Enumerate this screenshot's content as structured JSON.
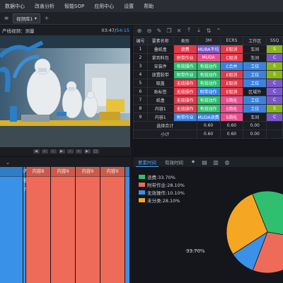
{
  "menu": [
    "数据中心",
    "改善分析",
    "智能SOP",
    "应用中心",
    "设置",
    "帮助"
  ],
  "toolbar": {
    "dropdown": "视频库1",
    "add_label": "+"
  },
  "video": {
    "title": "产线视频：测量",
    "time_current": "03:47",
    "time_total": "54:15",
    "separator": "/"
  },
  "table": {
    "columns": [
      "编号",
      "要素名称",
      "类别",
      "3M",
      "ECRS",
      "工作区",
      "SSQ"
    ],
    "rows": [
      {
        "id": "1",
        "name": "叠纸盒",
        "cat": "浪费",
        "m3": "MURA不均",
        "ecrs": "E取消",
        "area": "车间",
        "ssq": "S",
        "c_cat": "c-red",
        "c_m3": "c-purple",
        "c_ecrs": "c-red",
        "c_area": "c-dark",
        "c_ssq": "c-lime"
      },
      {
        "id": "2",
        "name": "拿到料包",
        "cat": "附带作业",
        "m3": "MUDA",
        "ecrs": "C取消",
        "area": "车间",
        "ssq": "C",
        "c_cat": "c-red",
        "c_m3": "c-pink",
        "c_ecrs": "c-red",
        "c_area": "c-dark",
        "c_ssq": "c-purple"
      },
      {
        "id": "3",
        "name": "安装件",
        "cat": "有效操作",
        "m3": "有效动作",
        "ecrs": "C合并",
        "area": "工位",
        "ssq": "S",
        "c_cat": "c-green",
        "c_m3": "c-green",
        "c_ecrs": "c-blue",
        "c_area": "c-blue",
        "c_ssq": "c-lime"
      },
      {
        "id": "4",
        "name": "放置胶带",
        "cat": "附带作业",
        "m3": "有效动作",
        "ecrs": "E取消",
        "area": "工位",
        "ssq": "S",
        "c_cat": "c-green",
        "c_m3": "c-green",
        "c_ecrs": "c-red",
        "c_area": "c-blue",
        "c_ssq": "c-lime"
      },
      {
        "id": "5",
        "name": "取盖",
        "cat": "无效操作",
        "m3": "有效动作",
        "ecrs": "E取消",
        "area": "工位",
        "ssq": "C",
        "c_cat": "c-red",
        "c_m3": "c-green",
        "c_ecrs": "c-red",
        "c_area": "c-blue",
        "c_ssq": "c-purple"
      },
      {
        "id": "6",
        "name": "贴标签",
        "cat": "无效操作",
        "m3": "附带动作",
        "ecrs": "E取消",
        "area": "区域外",
        "ssq": "C",
        "c_cat": "c-red",
        "c_m3": "c-blue",
        "c_ecrs": "c-red",
        "c_area": "c-dark",
        "c_ssq": "c-purple"
      },
      {
        "id": "7",
        "name": "纸盒",
        "cat": "无效操作",
        "m3": "有效动作",
        "ecrs": "S简化",
        "area": "工位",
        "ssq": "C",
        "c_cat": "c-red",
        "c_m3": "c-green",
        "c_ecrs": "c-pink",
        "c_area": "c-blue",
        "c_ssq": "c-purple"
      },
      {
        "id": "8",
        "name": "内容1",
        "cat": "无效操作",
        "m3": "有效动作",
        "ecrs": "S简化",
        "area": "工位",
        "ssq": "S",
        "c_cat": "c-red",
        "c_m3": "c-green",
        "c_ecrs": "c-pink",
        "c_area": "c-blue",
        "c_ssq": "c-lime"
      },
      {
        "id": "9",
        "name": "内容1",
        "cat": "附带作业",
        "m3": "MUDA浪费",
        "ecrs": "S简化",
        "area": "车间",
        "ssq": "C",
        "c_cat": "c-blue",
        "c_m3": "c-blue",
        "c_ecrs": "c-pink",
        "c_area": "c-dark",
        "c_ssq": "c-purple"
      }
    ],
    "summary": [
      {
        "label": "选择合计",
        "m3": "0.60",
        "ecrs": "0.60",
        "area": "0.00"
      },
      {
        "label": "小计",
        "m3": "0.60",
        "ecrs": "0.60",
        "area": "0.00"
      }
    ]
  },
  "timeline": {
    "segments": [
      {
        "label": "",
        "color": "#3a92e8",
        "w": 0.18
      },
      {
        "label": "内容7",
        "color": "#3a92e8",
        "w": 0.02
      },
      {
        "label": "",
        "color": "#ee6b5a",
        "w": 0.0
      },
      {
        "label": "内容8",
        "color": "#ee6b5a",
        "w": 0.19
      },
      {
        "label": "内容9",
        "color": "#ee6b5a",
        "w": 0.19
      },
      {
        "label": "内容9",
        "color": "#ee6b5a",
        "w": 0.19
      },
      {
        "label": "内容9",
        "color": "#ee6b5a",
        "w": 0.19
      },
      {
        "label": "",
        "color": "#3a92e8",
        "w": 0.04
      }
    ]
  },
  "chart_tabs": [
    "要素时间",
    "有效时间"
  ],
  "chart_data": {
    "type": "pie",
    "categories": [
      "浪费",
      "附带作业",
      "无效操作",
      "未分类"
    ],
    "values": [
      33.7,
      28.1,
      10.1,
      28.1
    ],
    "colors": [
      "#2fbf6f",
      "#ee6b5a",
      "#3a92e8",
      "#f5a623"
    ],
    "legend": [
      "浪费:33.70%",
      "附带作业:28.10%",
      "无效操作:10.10%",
      "未分类:28.10%"
    ],
    "data_label": "33.70%"
  }
}
